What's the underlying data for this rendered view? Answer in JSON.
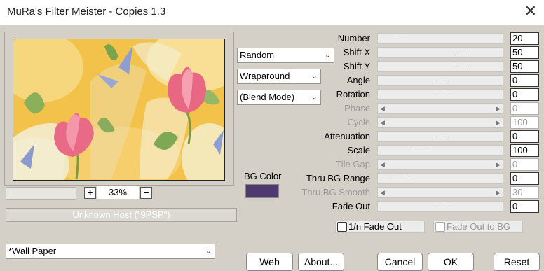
{
  "window": {
    "title": "MuRa's Filter Meister - Copies 1.3",
    "close_glyph": "✕"
  },
  "preview": {
    "zoom_value": "33%",
    "zoom_in": "+",
    "zoom_out": "−",
    "host_text": "Unknown Host (\"9PSP\")"
  },
  "combos": {
    "mode": "Random",
    "edge": "Wraparound",
    "blend": "(Blend Mode)",
    "preset": "*Wall Paper"
  },
  "bg_color": {
    "label": "BG Color",
    "color": "#4e3a6e"
  },
  "params": [
    {
      "label": "Number",
      "value": "20",
      "enabled": true
    },
    {
      "label": "Shift X",
      "value": "50",
      "enabled": true
    },
    {
      "label": "Shift Y",
      "value": "50",
      "enabled": true
    },
    {
      "label": "Angle",
      "value": "0",
      "enabled": true
    },
    {
      "label": "Rotation",
      "value": "0",
      "enabled": true
    },
    {
      "label": "Phase",
      "value": "0",
      "enabled": false
    },
    {
      "label": "Cycle",
      "value": "100",
      "enabled": false
    },
    {
      "label": "Attenuation",
      "value": "0",
      "enabled": true
    },
    {
      "label": "Scale",
      "value": "100",
      "enabled": true
    },
    {
      "label": "Tile Gap",
      "value": "0",
      "enabled": false
    },
    {
      "label": "Thru BG Range",
      "value": "0",
      "enabled": true
    },
    {
      "label": "Thru BG Smooth",
      "value": "30",
      "enabled": false
    },
    {
      "label": "Fade Out",
      "value": "0",
      "enabled": true
    }
  ],
  "checks": {
    "fade_1n": "1/n Fade Out",
    "fade_bg": "Fade Out to BG"
  },
  "buttons": {
    "web": "Web",
    "about": "About...",
    "cancel": "Cancel",
    "ok": "OK",
    "reset": "Reset"
  }
}
